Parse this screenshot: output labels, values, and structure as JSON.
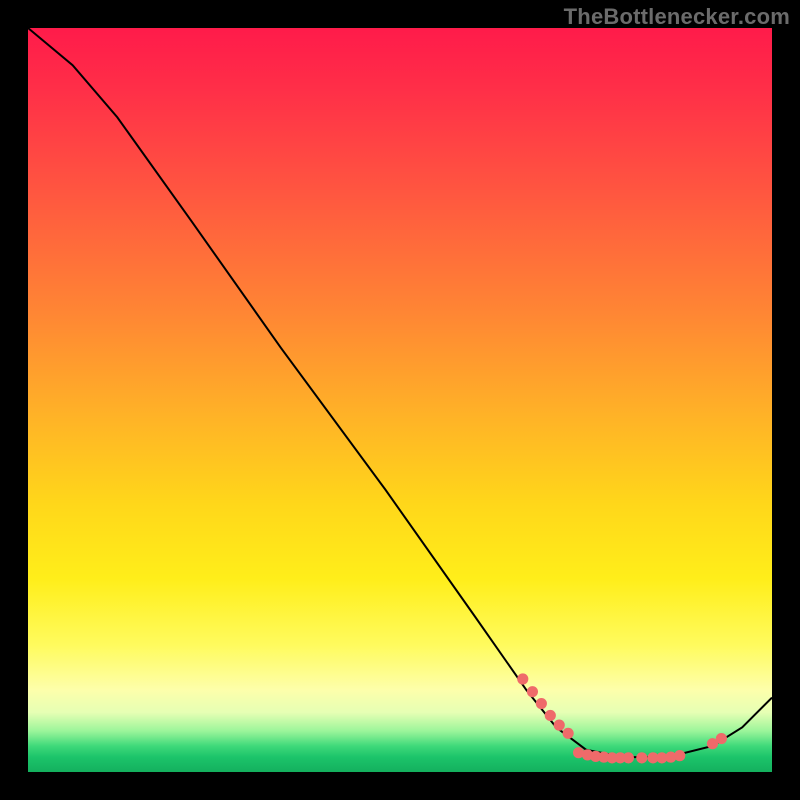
{
  "watermark": "TheBottlenecker.com",
  "chart_data": {
    "type": "line",
    "title": "",
    "xlabel": "",
    "ylabel": "",
    "xlim": [
      0,
      100
    ],
    "ylim": [
      0,
      100
    ],
    "curve": [
      {
        "x": 0,
        "y": 100
      },
      {
        "x": 6,
        "y": 95
      },
      {
        "x": 12,
        "y": 88
      },
      {
        "x": 22,
        "y": 74
      },
      {
        "x": 34,
        "y": 57
      },
      {
        "x": 48,
        "y": 38
      },
      {
        "x": 60,
        "y": 21
      },
      {
        "x": 67,
        "y": 11
      },
      {
        "x": 71,
        "y": 6
      },
      {
        "x": 75,
        "y": 3
      },
      {
        "x": 80,
        "y": 2
      },
      {
        "x": 86,
        "y": 2
      },
      {
        "x": 92,
        "y": 3.5
      },
      {
        "x": 96,
        "y": 6
      },
      {
        "x": 100,
        "y": 10
      }
    ],
    "markers": [
      {
        "x": 66.5,
        "y": 12.5
      },
      {
        "x": 67.8,
        "y": 10.8
      },
      {
        "x": 69.0,
        "y": 9.2
      },
      {
        "x": 70.2,
        "y": 7.6
      },
      {
        "x": 71.4,
        "y": 6.3
      },
      {
        "x": 72.6,
        "y": 5.2
      },
      {
        "x": 74.0,
        "y": 2.6
      },
      {
        "x": 75.2,
        "y": 2.3
      },
      {
        "x": 76.3,
        "y": 2.1
      },
      {
        "x": 77.4,
        "y": 2.0
      },
      {
        "x": 78.5,
        "y": 1.9
      },
      {
        "x": 79.6,
        "y": 1.9
      },
      {
        "x": 80.7,
        "y": 1.9
      },
      {
        "x": 82.5,
        "y": 1.9
      },
      {
        "x": 84.0,
        "y": 1.9
      },
      {
        "x": 85.2,
        "y": 1.9
      },
      {
        "x": 86.4,
        "y": 2.0
      },
      {
        "x": 87.6,
        "y": 2.2
      },
      {
        "x": 92.0,
        "y": 3.8
      },
      {
        "x": 93.2,
        "y": 4.5
      }
    ],
    "marker_color": "#ef6a6a",
    "curve_color": "#000000"
  }
}
